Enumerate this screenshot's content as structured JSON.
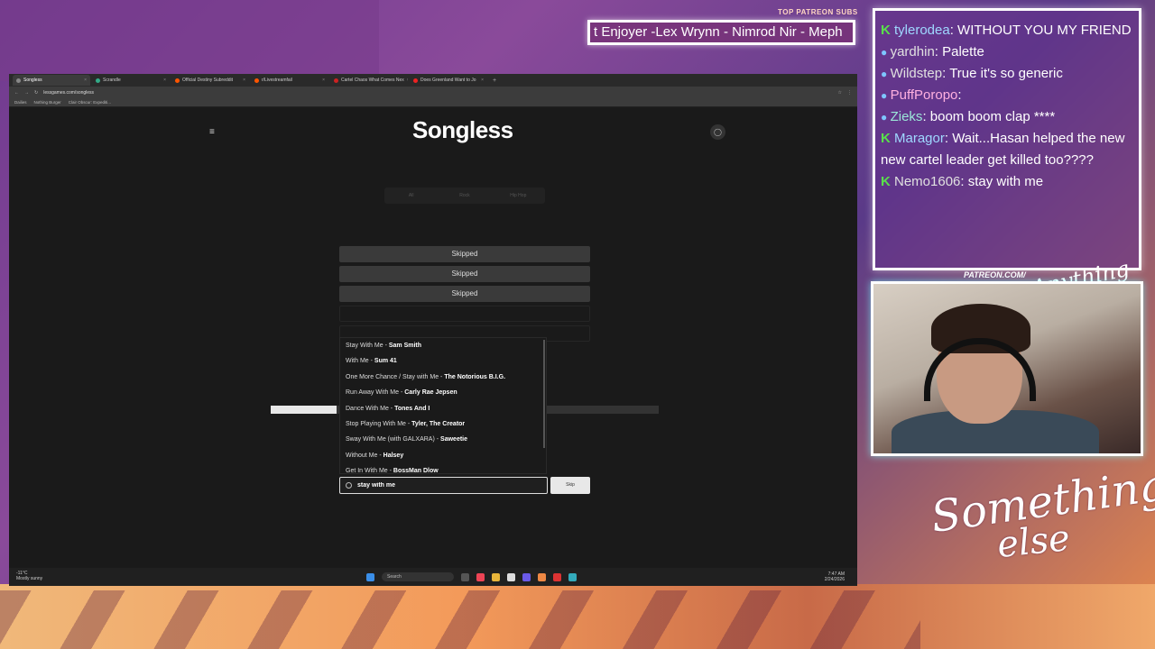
{
  "overlay": {
    "patreon_label": "TOP PATREON SUBS",
    "ticker_text": "t Enjoyer -Lex Wrynn - Nimrod Nir - Meph",
    "patreon_url": "PATREON.COM/",
    "script_logo": "Anything Else",
    "brand_line1": "Something",
    "brand_line2": "else"
  },
  "browser": {
    "tabs": [
      {
        "label": "Songless",
        "active": true
      },
      {
        "label": "Scrandle",
        "active": false
      },
      {
        "label": "Official Destiny Subreddit",
        "active": false
      },
      {
        "label": "r/Livestreamfail",
        "active": false
      },
      {
        "label": "Cartel Chaos What Comes Nex",
        "active": false
      },
      {
        "label": "Does Greenland Want to Jo",
        "active": false
      }
    ],
    "new_tab": "+",
    "url": "lessgames.com/songless",
    "bookmarks": [
      "Dailies",
      "Nothing Burger",
      "Clair Obscur: Expediti..."
    ]
  },
  "songless": {
    "logo": "Songless",
    "menu_icon": "hamburger-icon",
    "genres": [
      "All",
      "Rock",
      "Hip Hop"
    ],
    "guesses": [
      "Skipped",
      "Skipped",
      "Skipped"
    ],
    "progress_fraction": 0.17,
    "dropdown": [
      {
        "title": "Stay With Me",
        "artist": "Sam Smith"
      },
      {
        "title": "With Me",
        "artist": "Sum 41"
      },
      {
        "title": "One More Chance / Stay with Me",
        "artist": "The Notorious B.I.G."
      },
      {
        "title": "Run Away With Me",
        "artist": "Carly Rae Jepsen"
      },
      {
        "title": "Dance With Me",
        "artist": "Tones And I"
      },
      {
        "title": "Stop Playing With Me",
        "artist": "Tyler, The Creator"
      },
      {
        "title": "Sway With Me (with GALXARA)",
        "artist": "Saweetie"
      },
      {
        "title": "Without Me",
        "artist": "Halsey"
      },
      {
        "title": "Get In With Me",
        "artist": "BossMan Dlow"
      }
    ],
    "search_value": "stay with me",
    "skip_label": "Skip"
  },
  "taskbar": {
    "weather_temp": "-11°C",
    "weather_desc": "Mostly sunny",
    "search_label": "Search",
    "time": "7:47 AM",
    "date": "2/24/2026"
  },
  "chat": {
    "messages": [
      {
        "user": "tylerodea",
        "text": ": WITHOUT YOU MY FRIEND",
        "badge": "K",
        "color": "cyan"
      },
      {
        "user": "yardhin",
        "text": ": Palette",
        "badge": "P",
        "color": "white"
      },
      {
        "user": "Wildstep",
        "text": ": True it's so generic",
        "badge": "P",
        "color": "white"
      },
      {
        "user": "PuffPoropo",
        "text": ":",
        "badge": "P",
        "color": "pink"
      },
      {
        "user": "Zieks",
        "text": ": boom boom clap ****",
        "badge": "P",
        "color": "teal"
      },
      {
        "user": "Maragor",
        "text": ": Wait...Hasan helped the new new cartel leader get killed too????",
        "badge": "K",
        "color": "cyan"
      },
      {
        "user": "Nemo1606",
        "text": ": stay with me",
        "badge": "K",
        "color": "white"
      }
    ]
  }
}
